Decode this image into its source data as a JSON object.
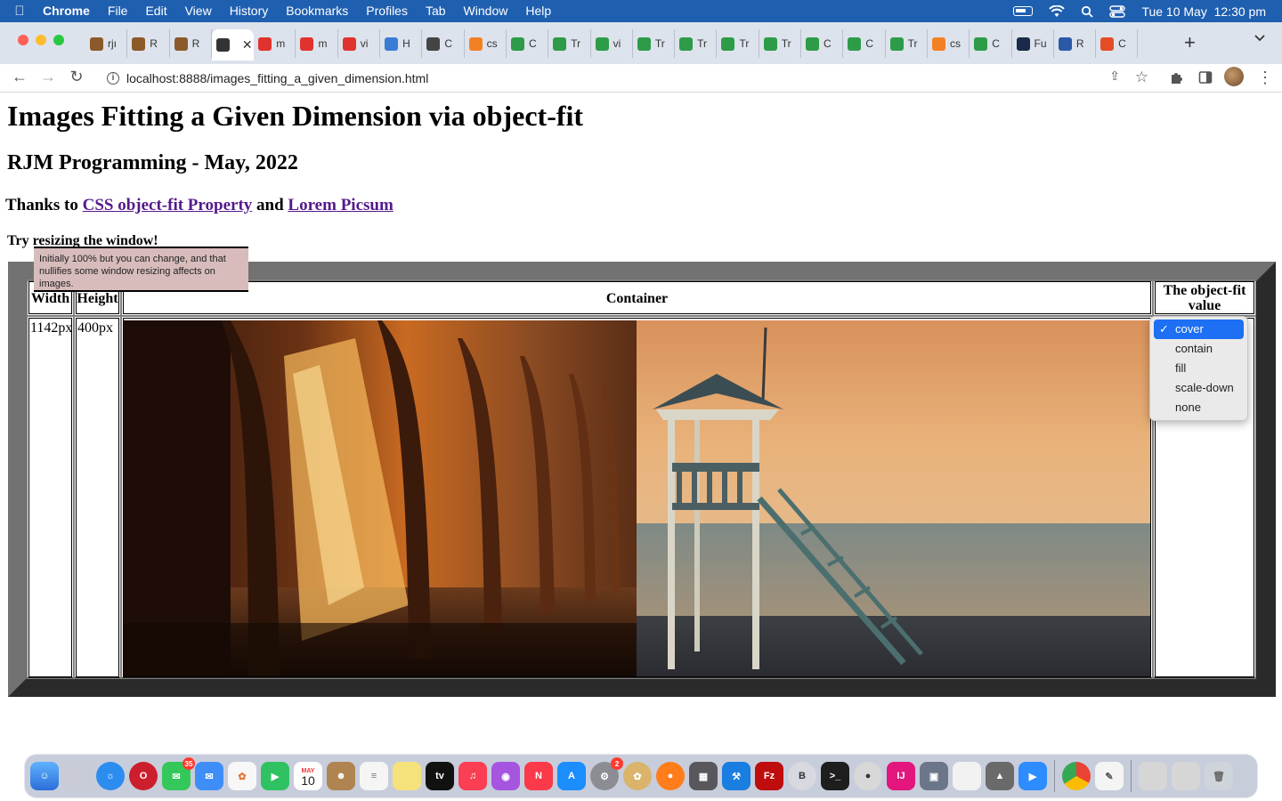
{
  "menubar": {
    "app_name": "Chrome",
    "items": [
      "File",
      "Edit",
      "View",
      "History",
      "Bookmarks",
      "Profiles",
      "Tab",
      "Window",
      "Help"
    ],
    "clock": "Tue 10 May  12:30 pm"
  },
  "tabs": [
    {
      "label": "rjı",
      "favicon": "pencil-icon",
      "color": "#8b5a2b"
    },
    {
      "label": "R",
      "favicon": "pencil-icon",
      "color": "#8b5a2b"
    },
    {
      "label": "R",
      "favicon": "pencil-icon",
      "color": "#8b5a2b"
    },
    {
      "label": "",
      "favicon": "github-icon",
      "color": "#333333",
      "active": true
    },
    {
      "label": "m",
      "favicon": "asterisk-icon",
      "color": "#e0332e"
    },
    {
      "label": "m",
      "favicon": "asterisk-icon",
      "color": "#e0332e"
    },
    {
      "label": "vi",
      "favicon": "asterisk-icon",
      "color": "#e0332e"
    },
    {
      "label": "H",
      "favicon": "puzzle-icon",
      "color": "#3a7bd5"
    },
    {
      "label": "C",
      "favicon": "text-icon",
      "color": "#444444"
    },
    {
      "label": "cs",
      "favicon": "stack-icon",
      "color": "#f48024"
    },
    {
      "label": "C",
      "favicon": "w3-icon",
      "color": "#2e9b49"
    },
    {
      "label": "Tr",
      "favicon": "w3-icon",
      "color": "#2e9b49"
    },
    {
      "label": "vi",
      "favicon": "w3-icon",
      "color": "#2e9b49"
    },
    {
      "label": "Tr",
      "favicon": "w3-icon",
      "color": "#2e9b49"
    },
    {
      "label": "Tr",
      "favicon": "w3-icon",
      "color": "#2e9b49"
    },
    {
      "label": "Tr",
      "favicon": "w3-icon",
      "color": "#2e9b49"
    },
    {
      "label": "Tr",
      "favicon": "w3-icon",
      "color": "#2e9b49"
    },
    {
      "label": "C",
      "favicon": "w3-icon",
      "color": "#2e9b49"
    },
    {
      "label": "C",
      "favicon": "w3-icon",
      "color": "#2e9b49"
    },
    {
      "label": "Tr",
      "favicon": "w3-icon",
      "color": "#2e9b49"
    },
    {
      "label": "cs",
      "favicon": "stack-icon",
      "color": "#f48024"
    },
    {
      "label": "C",
      "favicon": "w3-icon",
      "color": "#2e9b49"
    },
    {
      "label": "Fu",
      "favicon": "triangle-icon",
      "color": "#1b2a4a"
    },
    {
      "label": "R",
      "favicon": "circle-icon",
      "color": "#2b59a8"
    },
    {
      "label": "C",
      "favicon": "html-icon",
      "color": "#e44d26"
    }
  ],
  "address_bar": {
    "url": "localhost:8888/images_fitting_a_given_dimension.html"
  },
  "page": {
    "title": "Images Fitting a Given Dimension via object-fit",
    "subtitle": "RJM Programming - May, 2022",
    "thanks_prefix": "Thanks to",
    "link1": "CSS object-fit Property",
    "thanks_and": "and",
    "link2": "Lorem Picsum",
    "try_text": "Try resizing the window!",
    "tooltip": "Initially 100% but you can change, and that nullifies some window resizing affects on images."
  },
  "table": {
    "headers": [
      "Width",
      "Height",
      "Container",
      "The object-fit value"
    ],
    "width_value": "1142px",
    "height_value": "400px"
  },
  "dropdown": {
    "options": [
      "cover",
      "contain",
      "fill",
      "scale-down",
      "none"
    ],
    "selected": "cover"
  },
  "dock": {
    "messages_badge": "35",
    "calendar_month": "MAY",
    "calendar_day": "10",
    "settings_badge": "2"
  }
}
